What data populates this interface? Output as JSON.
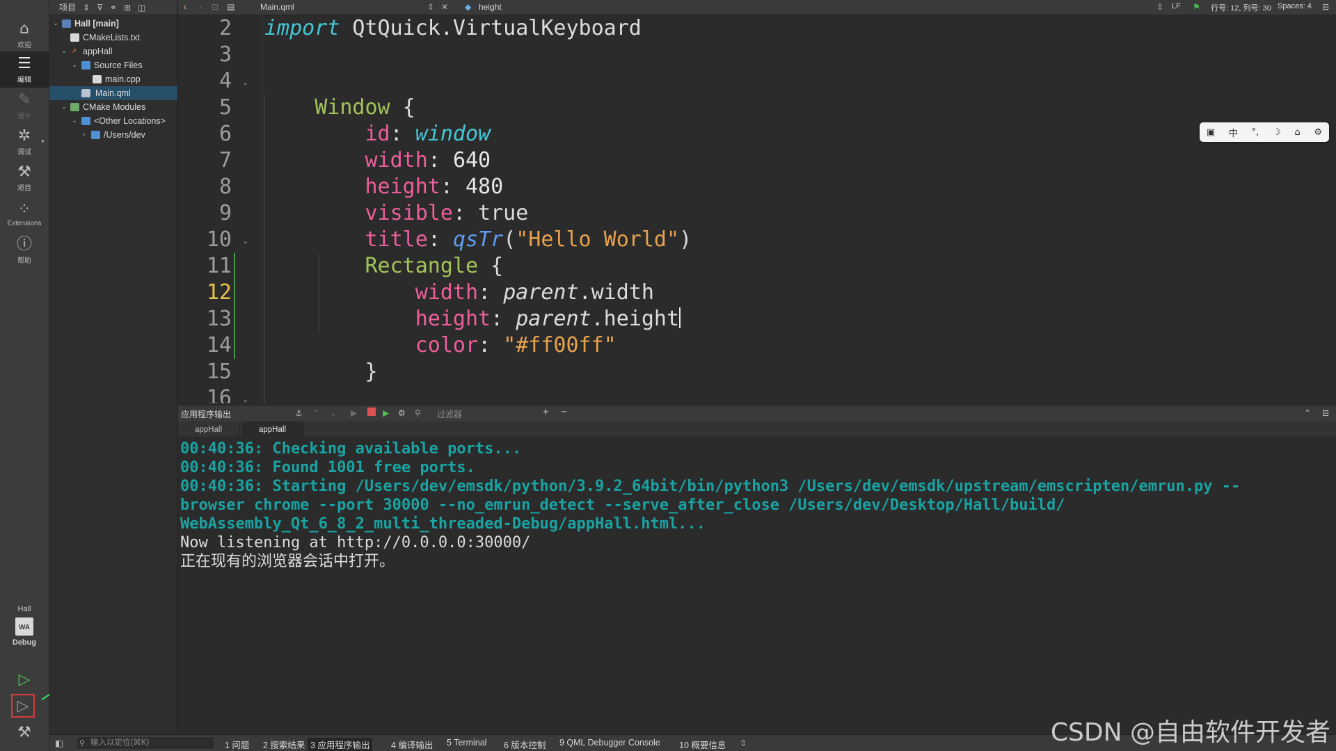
{
  "modebar": {
    "modes": [
      {
        "icon": "home-icon",
        "glyph": "⌂",
        "label": "欢迎"
      },
      {
        "icon": "edit-icon",
        "glyph": "☰",
        "label": "编辑"
      },
      {
        "icon": "design-icon",
        "glyph": "✎",
        "label": "设计"
      },
      {
        "icon": "debug-icon",
        "glyph": "✲",
        "label": "调试"
      },
      {
        "icon": "wrench-icon",
        "glyph": "⚒",
        "label": "项目"
      },
      {
        "icon": "extensions-icon",
        "glyph": "⁘",
        "label": "Extensions"
      },
      {
        "icon": "help-icon",
        "glyph": "?",
        "label": "帮助"
      }
    ],
    "kit": {
      "project": "Hall",
      "icon_text": "WA",
      "build": "Debug"
    }
  },
  "tree": {
    "toolbar_label": "项目",
    "items": [
      {
        "label": "Hall [main]",
        "bold": true
      },
      {
        "label": "CMakeLists.txt"
      },
      {
        "label": "appHall"
      },
      {
        "label": "Source Files"
      },
      {
        "label": "main.cpp"
      },
      {
        "label": "Main.qml",
        "selected": true
      },
      {
        "label": "CMake Modules"
      },
      {
        "label": "<Other Locations>"
      },
      {
        "label": "/Users/dev"
      }
    ]
  },
  "editor": {
    "file": "Main.qml",
    "symbol": "height",
    "line_ending": "LF",
    "position": "行号: 12, 列号: 30",
    "spaces": "Spaces: 4",
    "current_line": 12,
    "line_numbers": [
      "2",
      "3",
      "4",
      "5",
      "6",
      "7",
      "8",
      "9",
      "10",
      "11",
      "12",
      "13",
      "14",
      "15",
      "16"
    ]
  },
  "output": {
    "title": "应用程序输出",
    "filter_placeholder": "过滤器",
    "tabs": [
      "appHall",
      "appHall"
    ],
    "lines": [
      "00:40:36: Checking available ports...",
      "00:40:36: Found 1001 free ports.",
      "00:40:36: Starting /Users/dev/emsdk/python/3.9.2_64bit/bin/python3 /Users/dev/emsdk/upstream/emscripten/emrun.py --",
      "browser chrome --port 30000 --no_emrun_detect --serve_after_close /Users/dev/Desktop/Hall/build/",
      "WebAssembly_Qt_6_8_2_multi_threaded-Debug/appHall.html...",
      "Now listening at http://0.0.0.0:30000/",
      "正在现有的浏览器会话中打开。"
    ]
  },
  "ime": [
    "中",
    "°,",
    "☽",
    "⌂",
    "⚙"
  ],
  "statusbar": {
    "locator_placeholder": "输入以定位(⌘K)",
    "panes": [
      "1 问题",
      "2 搜索结果",
      "3 应用程序输出",
      "4 编译输出",
      "5 Terminal",
      "6 版本控制",
      "9 QML Debugger Console",
      "10 概要信息"
    ]
  },
  "watermark": "CSDN @自由软件开发者"
}
